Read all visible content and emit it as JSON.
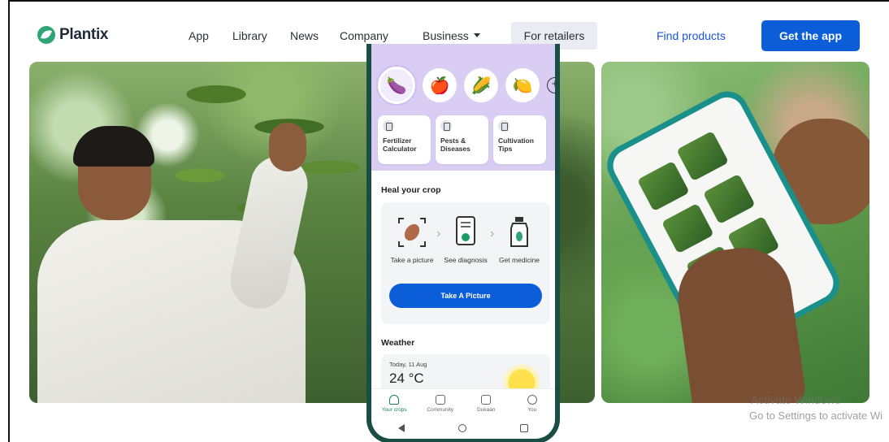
{
  "brand": {
    "name": "Plantix",
    "color": "#2fa577"
  },
  "nav": {
    "links": [
      "App",
      "Library",
      "News",
      "Company",
      "Business"
    ],
    "retailers": "For retailers",
    "find_products": "Find products",
    "get_app": "Get the app"
  },
  "app": {
    "crops": [
      {
        "icon": "🍆",
        "name": "eggplant-icon"
      },
      {
        "icon": "🍎",
        "name": "apple-icon"
      },
      {
        "icon": "🌽",
        "name": "corn-icon"
      },
      {
        "icon": "🍋",
        "name": "lemon-icon"
      }
    ],
    "tools": [
      "Fertilizer Calculator",
      "Pests & Diseases",
      "Cultivation Tips"
    ],
    "heal_title": "Heal your crop",
    "steps": [
      "Take a picture",
      "See diagnosis",
      "Get medicine"
    ],
    "take_picture": "Take A Picture",
    "weather_title": "Weather",
    "weather_date": "Today, 11 Aug",
    "weather_temp": "24 °C",
    "bottom_nav": [
      "Your crops",
      "Community",
      "Dukaan",
      "You"
    ]
  },
  "watermark": {
    "line1": "Activate Windows",
    "line2": "Go to Settings to activate Wi"
  },
  "colors": {
    "primary": "#0b5ed7",
    "panel": "#d9cdf3",
    "phone_frame": "#1a4d44"
  }
}
